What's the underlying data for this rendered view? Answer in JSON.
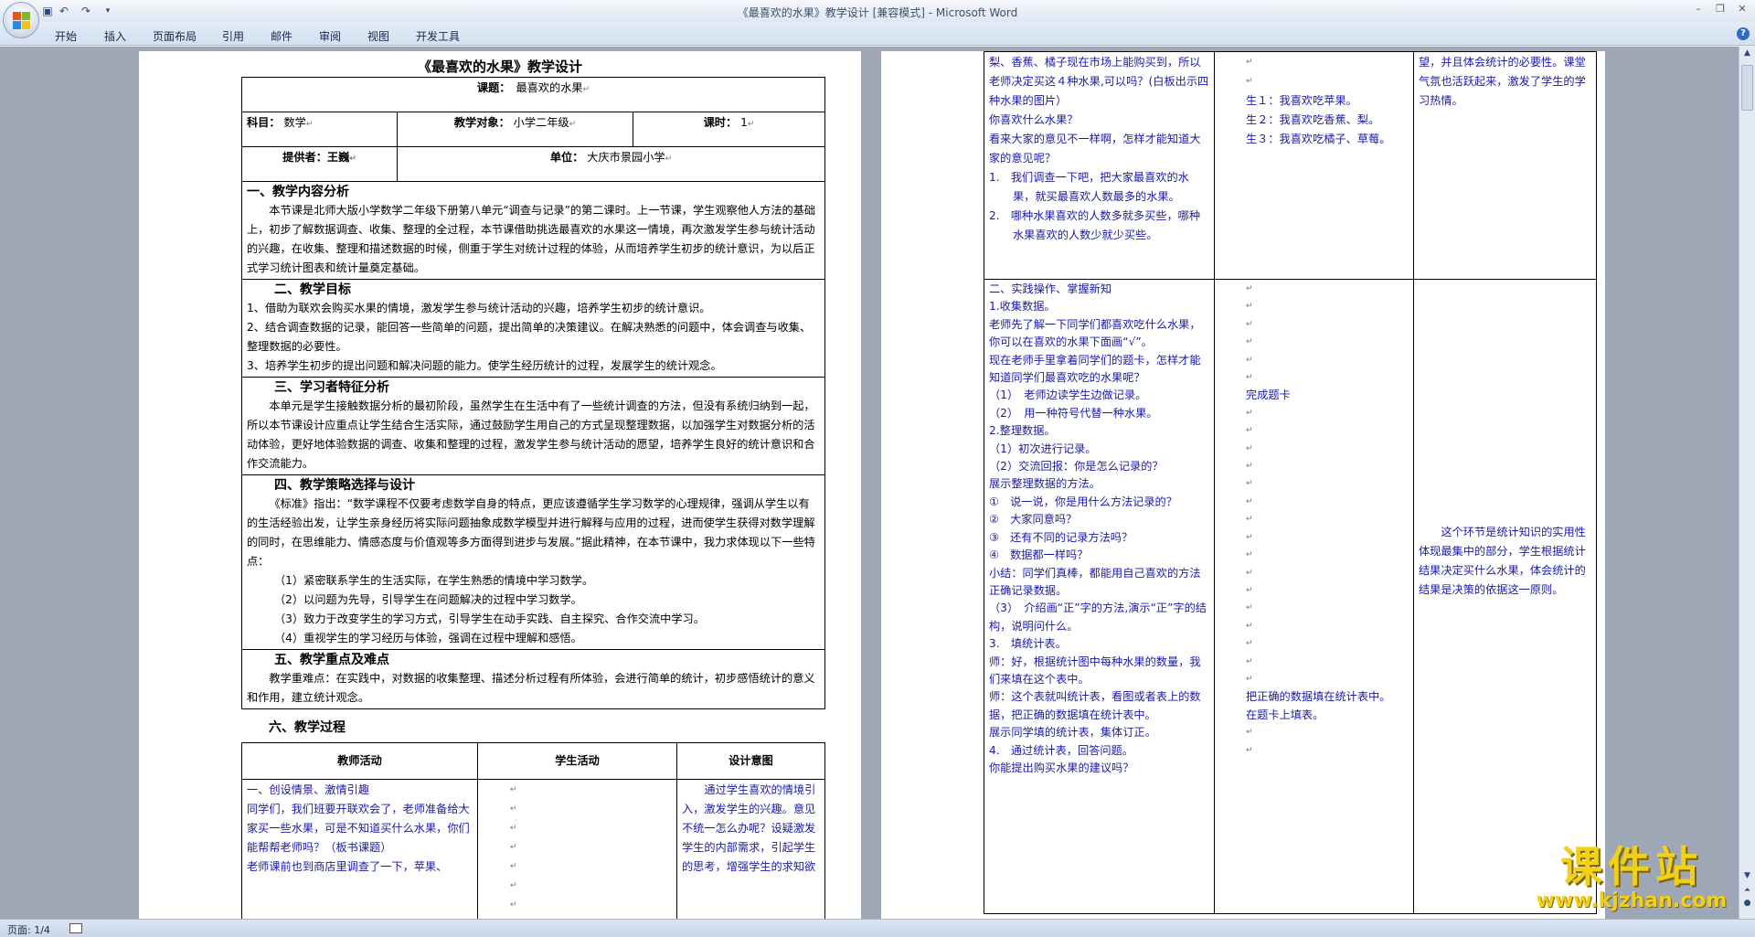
{
  "app": {
    "window_title": "《最喜欢的水果》教学设计 [兼容模式] - Microsoft Word"
  },
  "ribbon": {
    "tabs": [
      "开始",
      "插入",
      "页面布局",
      "引用",
      "邮件",
      "审阅",
      "视图",
      "开发工具"
    ]
  },
  "status": {
    "page": "页面: 1/4"
  },
  "watermark": {
    "main": "课件站",
    "url": "www.kjzhan.com"
  },
  "page1": {
    "title": "《最喜欢的水果》教学设计",
    "topic_label": "课题：",
    "topic_value": "最喜欢的水果",
    "subject_label": "科目：",
    "subject_value": "数学",
    "audience_label": "教学对象：",
    "audience_value": "小学二年级",
    "hours_label": "课时：",
    "hours_value": "1",
    "provider_label": "提供者：王巍",
    "unit_label": "单位：",
    "unit_value": "大庆市景园小学",
    "s1_title": "一、教学内容分析",
    "s1_text": "本节课是北师大版小学数学二年级下册第八单元“调查与记录”的第二课时。上一节课，学生观察他人方法的基础上，初步了解数据调查、收集、整理的全过程，本节课借助挑选最喜欢的水果这一情境，再次激发学生参与统计活动的兴趣，在收集、整理和描述数据的时候，侧重于学生对统计过程的体验，从而培养学生初步的统计意识，为以后正式学习统计图表和统计量奠定基础。",
    "s2_title": "二、教学目标",
    "s2_items": [
      "1、借助为联欢会购买水果的情境，激发学生参与统计活动的兴趣，培养学生初步的统计意识。",
      "2、结合调查数据的记录，能回答一些简单的问题，提出简单的决策建议。在解决熟悉的问题中，体会调查与收集、整理数据的必要性。",
      "3、培养学生初步的提出问题和解决问题的能力。使学生经历统计的过程，发展学生的统计观念。"
    ],
    "s3_title": "三、学习者特征分析",
    "s3_text": "本单元是学生接触数据分析的最初阶段，虽然学生在生活中有了一些统计调查的方法，但没有系统归纳到一起，所以本节课设计应重点让学生结合生活实际，通过鼓励学生用自己的方式呈现整理数据，以加强学生对数据分析的活动体验，更好地体验数据的调查、收集和整理的过程，激发学生参与统计活动的愿望，培养学生良好的统计意识和合作交流能力。",
    "s4_title": "四、教学策略选择与设计",
    "s4_text": "《标准》指出：“数学课程不仅要考虑数学自身的特点，更应该遵循学生学习数学的心理规律，强调从学生以有的生活经验出发，让学生亲身经历将实际问题抽象成数学模型并进行解释与应用的过程，进而使学生获得对数学理解的同时，在思维能力、情感态度与价值观等多方面得到进步与发展。”据此精神，在本节课中，我力求体现以下一些特点：",
    "s4_items": [
      "（1）紧密联系学生的生活实际，在学生熟悉的情境中学习数学。",
      "（2）以问题为先导，引导学生在问题解决的过程中学习数学。",
      "（3）致力于改变学生的学习方式，引导学生在动手实践、自主探究、合作交流中学习。",
      "（4）重视学生的学习经历与体验，强调在过程中理解和感悟。"
    ],
    "s5_title": "五、教学重点及难点",
    "s5_text": "教学重难点：在实践中，对数据的收集整理、描述分析过程有所体验，会进行简单的统计，初步感悟统计的意义和作用，建立统计观念。",
    "s6_title": "六、教学过程",
    "col_teacher": "教师活动",
    "col_student": "学生活动",
    "col_design": "设计意图",
    "teacher_lines": [
      "一、创设情景、激情引趣",
      "同学们，我们班要开联欢会了，老师准备给大家买一些水果，可是不知道买什么水果，你们能帮帮老师吗？（板书课题）",
      "老师课前也到商店里调查了一下，苹果、"
    ],
    "design_text": "通过学生喜欢的情境引入，激发学生的兴趣。意见不统一怎么办呢？设疑激发学生的内部需求，引起学生的思考，增强学生的求知欲"
  },
  "page2": {
    "row1_teacher": [
      "梨、香蕉、橘子现在市场上能购买到，所以老师决定买这４种水果,可以吗？(白板出示四种水果的图片）",
      "你喜欢什么水果？",
      "看来大家的意见不一样啊，怎样才能知道大家的意见呢？",
      "1.　我们调查一下吧，把大家最喜欢的水果，就买最喜欢人数最多的水果。",
      "2.　哪种水果喜欢的人数多就多买些，哪种水果喜欢的人数少就少买些。"
    ],
    "row1_student": [
      "生１：我喜欢吃苹果。",
      "生２：我喜欢吃香蕉、梨。",
      "生３：我喜欢吃橘子、草莓。"
    ],
    "row1_design": "望，并且体会统计的必要性。课堂气氛也活跃起来，激发了学生的学习热情。",
    "row2_teacher": [
      "二、实践操作、掌握新知",
      "1.收集数据。",
      "老师先了解一下同学们都喜欢吃什么水果，你可以在喜欢的水果下面画“√”。",
      "现在老师手里拿着同学们的题卡，怎样才能知道同学们最喜欢吃的水果呢？",
      "（1）　老师边读学生边做记录。",
      "（2）　用一种符号代替一种水果。",
      "2.整理数据。",
      "（1）初次进行记录。",
      "（2）交流回报：你是怎么记录的？",
      "展示整理数据的方法。",
      "①　说一说，你是用什么方法记录的？",
      "②　大家同意吗？",
      "③　还有不同的记录方法吗？",
      "④　数据都一样吗？",
      "小结：同学们真棒，都能用自己喜欢的方法正确记录数据。",
      "（3）　介绍画“正”字的方法,演示“正”字的结构，说明问什么。",
      "3.　填统计表。",
      "师：好，根据统计图中每种水果的数量，我们来填在这个表中。",
      "师：这个表就叫统计表，看图或者表上的数据，把正确的数据填在统计表中。",
      "展示同学填的统计表，集体订正。",
      "4.　通过统计表，回答问题。",
      "你能提出购买水果的建议吗？"
    ],
    "row2_student_a": "完成题卡",
    "row2_student_b": "把正确的数据填在统计表中。",
    "row2_student_c": "在题卡上填表。",
    "row2_design": "这个环节是统计知识的实用性体现最集中的部分，学生根据统计结果决定买什么水果，体会统计的结果是决策的依据这一原则。"
  }
}
